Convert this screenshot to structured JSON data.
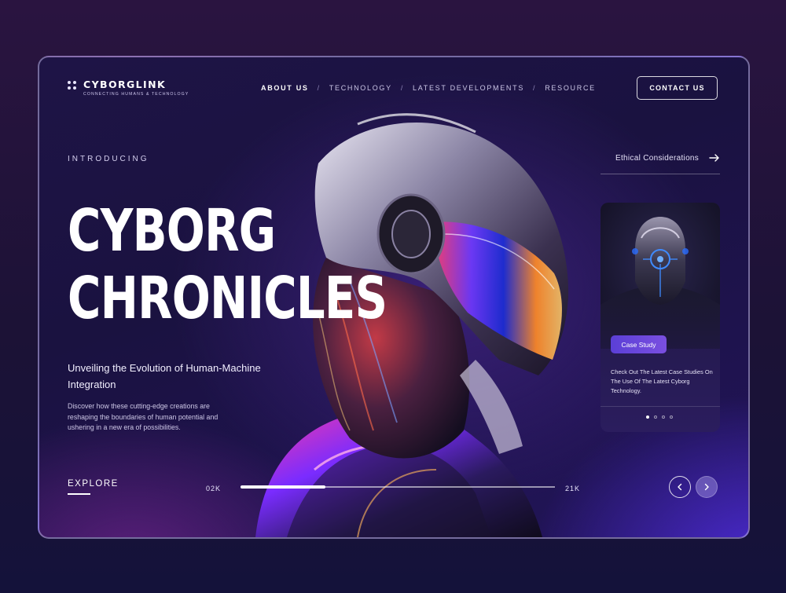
{
  "header": {
    "logo_name": "CYBORGLINK",
    "logo_tagline": "CONNECTING HUMANS & TECHNOLOGY",
    "nav": [
      {
        "label": "ABOUT US",
        "active": true
      },
      {
        "label": "TECHNOLOGY",
        "active": false
      },
      {
        "label": "LATEST DEVELOPMENTS",
        "active": false
      },
      {
        "label": "RESOURCE",
        "active": false
      }
    ],
    "nav_separator": "/",
    "contact_label": "CONTACT US"
  },
  "hero": {
    "eyebrow": "INTRODUCING",
    "title_line1": "CYBORG",
    "title_line2": "CHRONICLES",
    "subtitle": "Unveiling the Evolution of Human-Machine Integration",
    "description": "Discover how these cutting-edge creations are reshaping the boundaries of human potential and ushering in a new era of possibilities.",
    "explore_label": "EXPLORE"
  },
  "progress": {
    "min_label": "02K",
    "max_label": "21K",
    "fill_fraction": 0.27
  },
  "sidebar": {
    "link_label": "Ethical Considerations",
    "card": {
      "badge": "Case Study",
      "text": "Check Out The Latest Case Studies On The Use Of The Latest Cyborg Technology.",
      "dots_total": 4,
      "dots_active_index": 0
    }
  },
  "colors": {
    "accent": "#6a47dc",
    "background": "#1c1236"
  },
  "icons": {
    "logo": "four-dots-icon",
    "arrow_right": "arrow-right-icon",
    "prev": "chevron-left-icon",
    "next": "chevron-right-icon"
  }
}
